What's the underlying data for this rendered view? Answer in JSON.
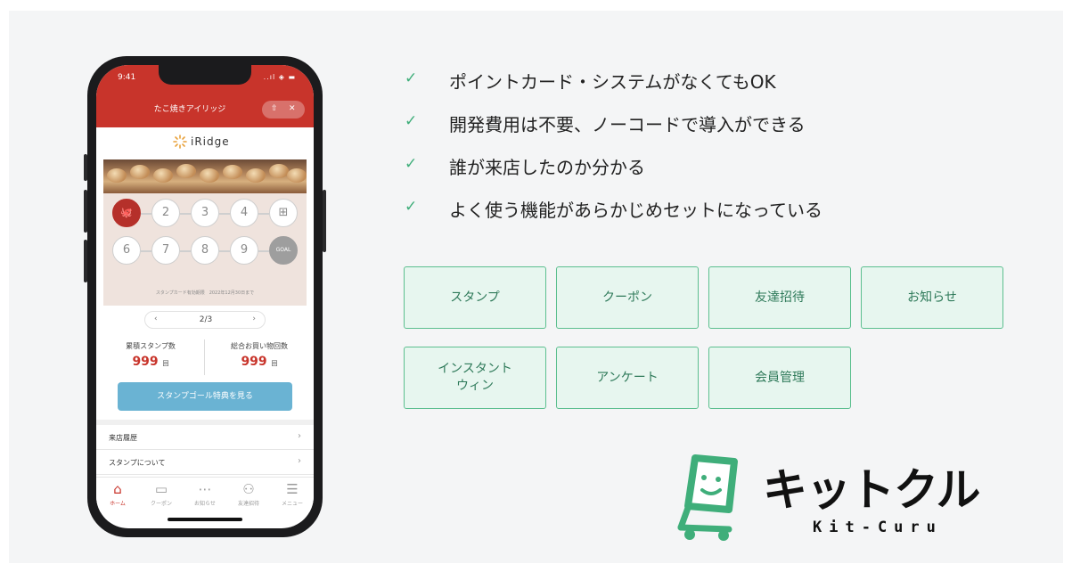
{
  "phone": {
    "status_time": "9:41",
    "status_signal": "..ıl ◈ ▬",
    "header_title": "たこ焼きアイリッジ",
    "share_icon": "share-icon",
    "close_icon": "close-icon",
    "brand_logo_text": "iRidge",
    "stamps_row1": [
      "",
      "2",
      "3",
      "4",
      ""
    ],
    "stamps_row2": [
      "6",
      "7",
      "8",
      "9",
      "GOAL"
    ],
    "expiry_text": "スタンプカード有効期限　2022年12月30日まで",
    "pager": {
      "prev": "‹",
      "current": "2/3",
      "next": "›"
    },
    "stats": [
      {
        "label": "累積スタンプ数",
        "value": "999",
        "unit": "回"
      },
      {
        "label": "総合お買い物回数",
        "value": "999",
        "unit": "回"
      }
    ],
    "cta_label": "スタンプゴール特典を見る",
    "menu": [
      {
        "label": "来店履歴",
        "chevron": "›"
      },
      {
        "label": "スタンプについて",
        "chevron": "›"
      }
    ],
    "tabs": [
      {
        "icon": "⌂",
        "label": "ホーム",
        "active": true
      },
      {
        "icon": "▭",
        "label": "クーポン",
        "active": false
      },
      {
        "icon": "⋯",
        "label": "お知らせ",
        "active": false
      },
      {
        "icon": "⚇",
        "label": "友達招待",
        "active": false
      },
      {
        "icon": "☰",
        "label": "メニュー",
        "active": false
      }
    ]
  },
  "features": [
    {
      "check": "✓",
      "text": "ポイントカード・システムがなくてもOK"
    },
    {
      "check": "✓",
      "text": "開発費用は不要、ノーコードで導入ができる"
    },
    {
      "check": "✓",
      "text": "誰が来店したのか分かる"
    },
    {
      "check": "✓",
      "text": "よく使う機能があらかじめセットになっている"
    }
  ],
  "functions": [
    "スタンプ",
    "クーポン",
    "友達招待",
    "お知らせ",
    "インスタント\nウィン",
    "アンケート",
    "会員管理"
  ],
  "brand": {
    "name": "キットクル",
    "sub": "Kit-Curu",
    "accent_color": "#3fae7a"
  }
}
